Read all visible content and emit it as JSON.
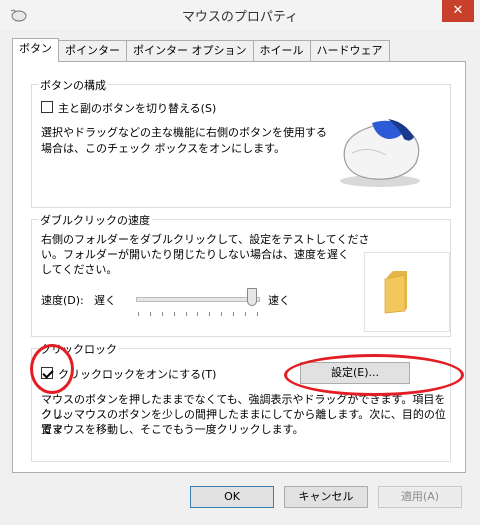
{
  "window": {
    "title": "マウスのプロパティ",
    "close_glyph": "✕"
  },
  "tabs": [
    {
      "label": "ボタン",
      "active": true
    },
    {
      "label": "ポインター",
      "active": false
    },
    {
      "label": "ポインター オプション",
      "active": false
    },
    {
      "label": "ホイール",
      "active": false
    },
    {
      "label": "ハードウェア",
      "active": false
    }
  ],
  "button_config": {
    "title": "ボタンの構成",
    "swap_checkbox_label": "主と副のボタンを切り替える(S)",
    "swap_checked": false,
    "description_line1": "選択やドラッグなどの主な機能に右側のボタンを使用する",
    "description_line2": "場合は、このチェック ボックスをオンにします。"
  },
  "double_click": {
    "title": "ダブルクリックの速度",
    "description_line1": "右側のフォルダーをダブルクリックして、設定をテストしてくださ",
    "description_line2": "い。フォルダーが開いたり閉じたりしない場合は、速度を遅く",
    "description_line3": "してください。",
    "speed_label": "速度(D):",
    "slow_label": "遅く",
    "fast_label": "速く",
    "slider_value": 0.9
  },
  "click_lock": {
    "title": "クリックロック",
    "checkbox_label": "クリックロックをオンにする(T)",
    "checked": true,
    "settings_button": "設定(E)...",
    "description_line1": "マウスのボタンを押したままでなくても、強調表示やドラッグができます。項目をクリッ",
    "description_line2": "クし、マウスのボタンを少しの間押したままにしてから離します。次に、目的の位置ま",
    "description_line3": "でマウスを移動し、そこでもう一度クリックします。"
  },
  "footer": {
    "ok": "OK",
    "cancel": "キャンセル",
    "apply": "適用(A)"
  },
  "colors": {
    "annotation_red": "#e21e24",
    "close_button": "#c7402b",
    "mouse_accent": "#2c5bd8",
    "folder": "#f2c75c"
  }
}
